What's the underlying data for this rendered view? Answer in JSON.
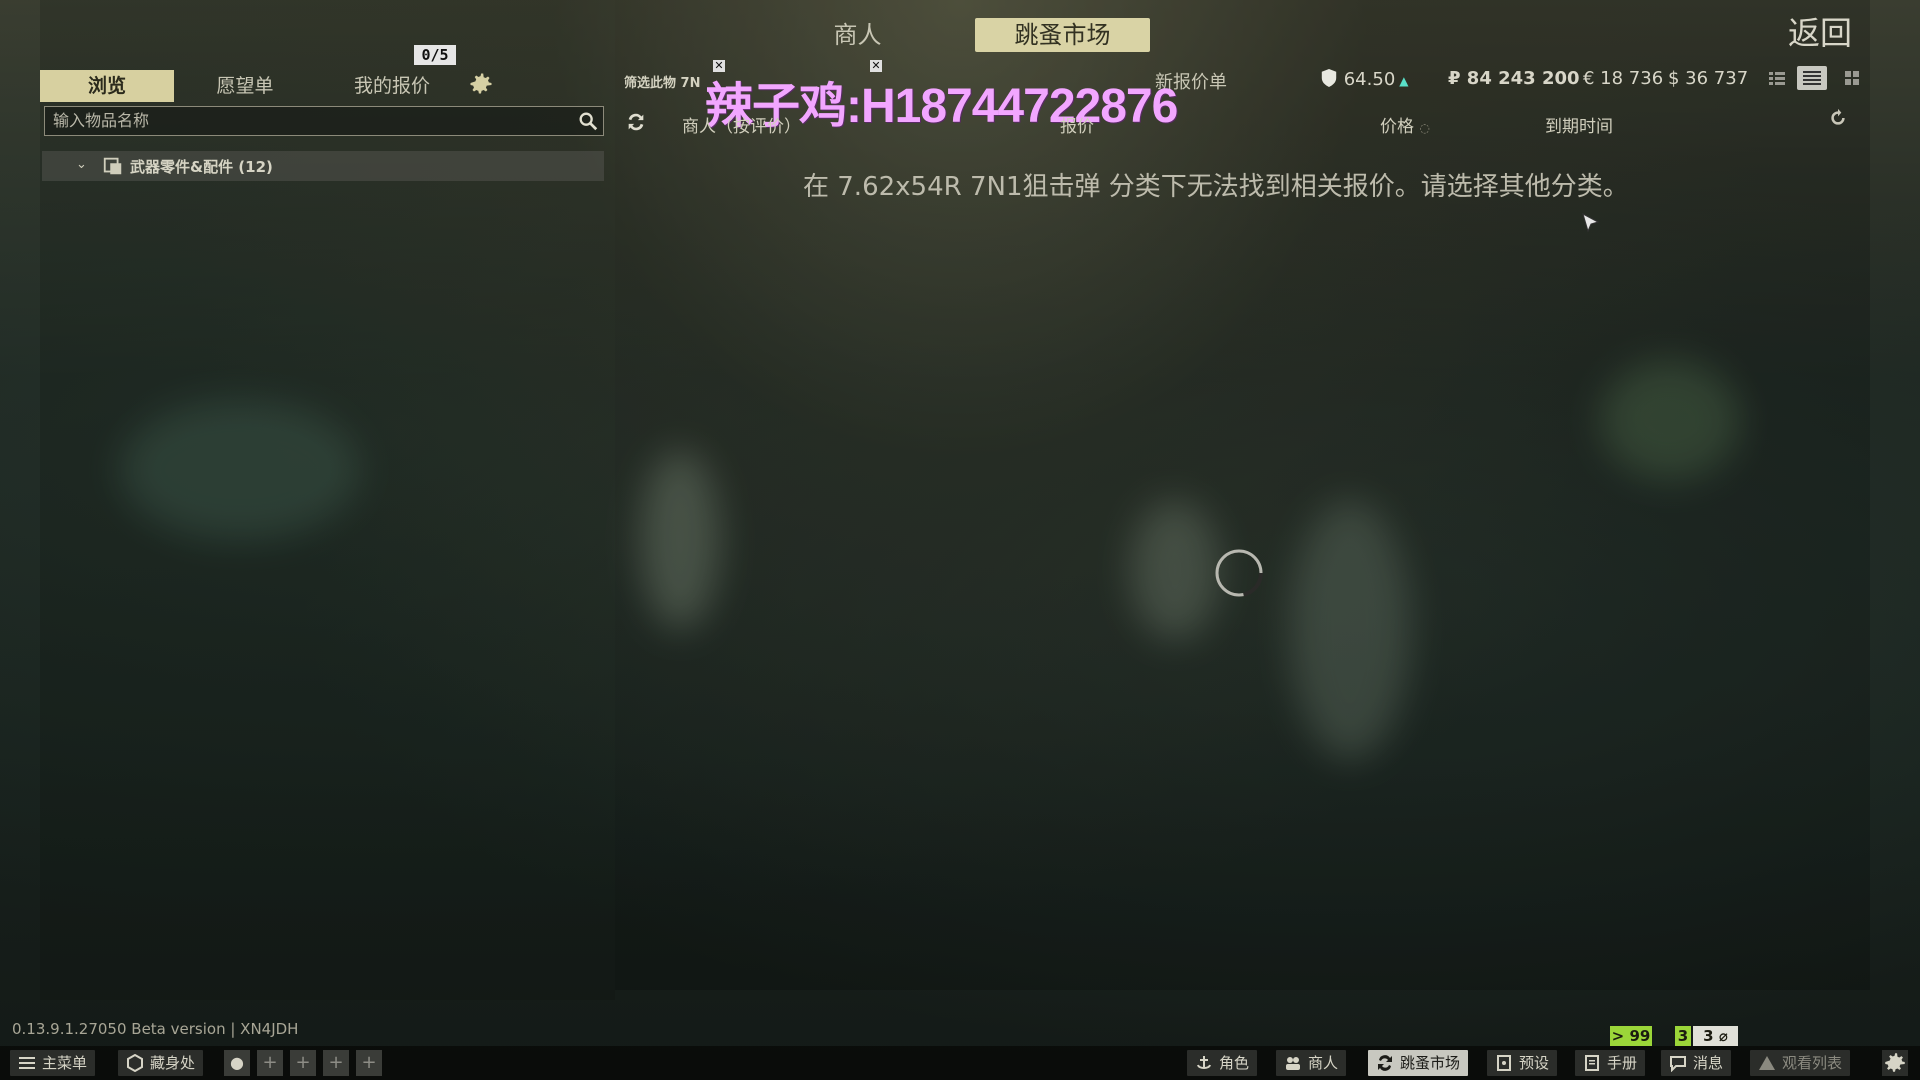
{
  "top_tabs": {
    "traders": "商人",
    "flea_market": "跳蚤市场"
  },
  "back_label": "返回",
  "left_tabs": {
    "browse": "浏览",
    "wishlist": "愿望单",
    "my_offers": "我的报价"
  },
  "offer_count": "0/5",
  "search": {
    "placeholder": "输入物品名称",
    "value": ""
  },
  "tree": {
    "category": "武器零件&配件 (12)"
  },
  "filters": {
    "filter_text": "筛选此物 7N",
    "add_offer": "新报价单"
  },
  "watermark": "辣子鸡:H18744722876",
  "rating": "64.50",
  "currencies": {
    "rub": "₽ 84 243 200",
    "eur": "€ 18 736",
    "usd": "$ 36 737"
  },
  "columns": {
    "trader": "商人（按评价）",
    "offer": "报价",
    "price": "价格",
    "expiration": "到期时间"
  },
  "no_offers_message": "在 7.62x54R 7N1狙击弹 分类下无法找到相关报价。请选择其他分类。",
  "version": "0.13.9.1.27050 Beta version | XN4JDH",
  "badges": {
    "b1": "> 99",
    "b2": "3",
    "b3": "3"
  },
  "bottom_bar": {
    "main_menu": "主菜单",
    "hideout": "藏身处",
    "character": "角色",
    "traders": "商人",
    "flea_market": "跳蚤市场",
    "presets": "预设",
    "handbook": "手册",
    "messages": "消息",
    "watchlist": "观看列表"
  },
  "colors": {
    "accent": "#d7d0a0",
    "watermark": "#f2a6ff",
    "badge_green": "#9bd639"
  }
}
